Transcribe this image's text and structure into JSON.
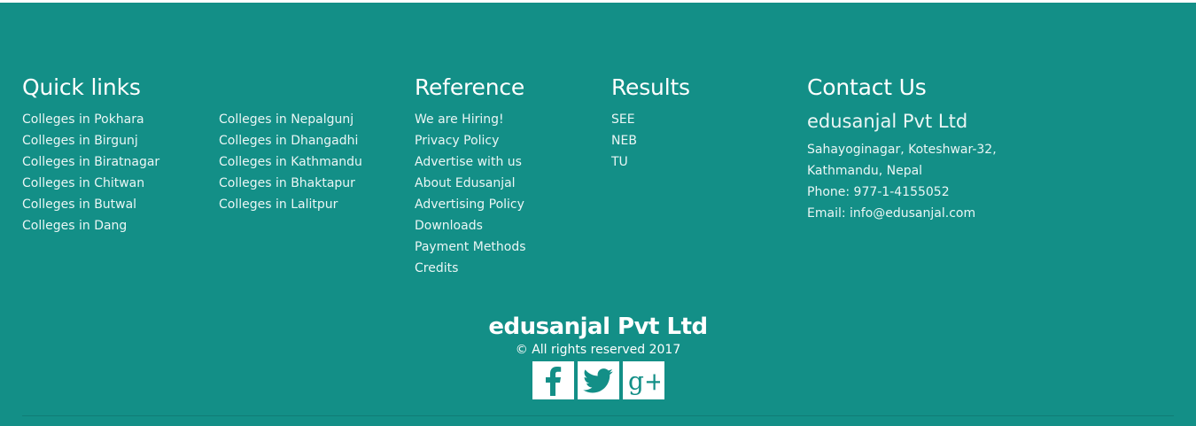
{
  "quick_links": {
    "heading": "Quick links",
    "col_a": [
      "Colleges in Pokhara",
      "Colleges in Birgunj",
      "Colleges in Biratnagar",
      "Colleges in Chitwan",
      "Colleges in Butwal",
      "Colleges in Dang"
    ],
    "col_b": [
      "Colleges in Nepalgunj",
      "Colleges in Dhangadhi",
      "Colleges in Kathmandu",
      "Colleges in Bhaktapur",
      "Colleges in Lalitpur"
    ]
  },
  "reference": {
    "heading": "Reference",
    "items": [
      "We are Hiring!",
      "Privacy Policy",
      "Advertise with us",
      "About Edusanjal",
      "Advertising Policy",
      "Downloads",
      "Payment Methods",
      "Credits"
    ]
  },
  "results": {
    "heading": "Results",
    "items": [
      "SEE",
      "NEB",
      "TU"
    ]
  },
  "contact": {
    "heading": "Contact Us",
    "company": "edusanjal Pvt Ltd",
    "address_line1": "Sahayoginagar, Koteshwar-32,",
    "address_line2": "Kathmandu, Nepal",
    "phone": "Phone: 977-1-4155052",
    "email": "Email: info@edusanjal.com"
  },
  "bottom": {
    "brand": "edusanjal Pvt Ltd",
    "copyright": "© All rights reserved 2017"
  },
  "social": [
    {
      "icon": "facebook-icon"
    },
    {
      "icon": "twitter-icon"
    },
    {
      "icon": "google-plus-icon",
      "glyph": "g+"
    }
  ],
  "colors": {
    "footer_bg": "#138f87",
    "icon_fg": "#138f87",
    "text": "#ffffff"
  }
}
